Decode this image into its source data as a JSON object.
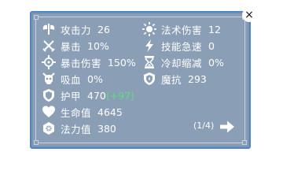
{
  "close_label": "×",
  "stats_left": [
    {
      "icon": "axe-icon",
      "label": "攻击力",
      "value": "26"
    },
    {
      "icon": "crossed-swords-icon",
      "label": "暴击",
      "value": "10%"
    },
    {
      "icon": "crosshair-icon",
      "label": "暴击伤害",
      "value": "150%"
    },
    {
      "icon": "vampire-skull-icon",
      "label": "吸血",
      "value": "0%"
    },
    {
      "icon": "shield-icon",
      "label": "护甲",
      "value": "470",
      "bonus": "(+97)"
    },
    {
      "icon": "heart-icon",
      "label": "生命值",
      "value": "4645"
    },
    {
      "icon": "mana-crystal-icon",
      "label": "法力值",
      "value": "380"
    }
  ],
  "stats_right": [
    {
      "icon": "sun-burst-icon",
      "label": "法术伤害",
      "value": "12"
    },
    {
      "icon": "lightning-icon",
      "label": "技能急速",
      "value": "0"
    },
    {
      "icon": "hourglass-icon",
      "label": "冷却缩减",
      "value": "0%"
    },
    {
      "icon": "magic-shield-icon",
      "label": "魔抗",
      "value": "293"
    }
  ],
  "pager": {
    "text": "(1/4)"
  },
  "colors": {
    "panel": "#8a9fb6",
    "border": "#4a86cc",
    "bonus": "#58e07a"
  }
}
